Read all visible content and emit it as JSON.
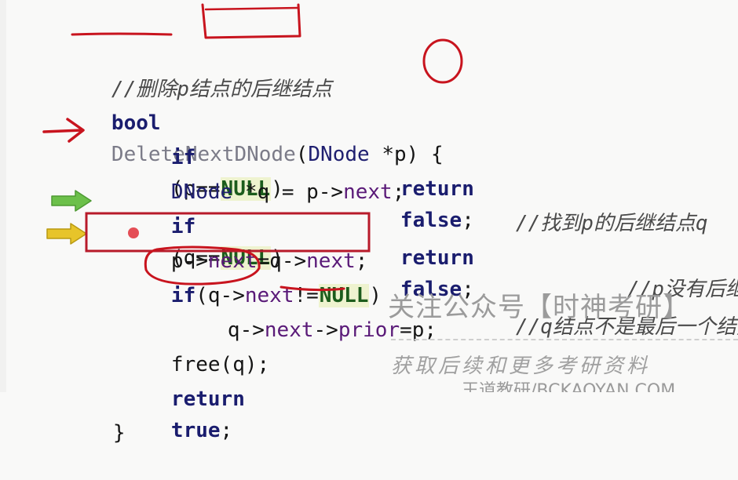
{
  "code": {
    "comment_header": "//删除p结点的后继结点",
    "l1": {
      "kw": "bool",
      "fn": "DeleteNextDNode",
      "open": "(",
      "type": "DNode",
      "param": " *p",
      "close": ") {"
    },
    "l2": {
      "kw_if": "if",
      "cond_open": "(p==",
      "null": "NULL",
      "cond_close": ")",
      "ret": "return",
      "val": "false",
      "semi": ";"
    },
    "l3": {
      "type": "DNode",
      "code": " *q = p->",
      "field": "next",
      "semi": ";",
      "comment": "//找到p的后继结点q"
    },
    "l4": {
      "kw_if": "if",
      "cond_open": "(q==",
      "null": "NULL",
      "cond_close": ")",
      "ret": "return",
      "val": "false",
      "semi": ";",
      "comment": "//p没有后继"
    },
    "l5": {
      "a": "p->",
      "f1": "next",
      "b": "=q->",
      "f2": "next",
      "semi": ";"
    },
    "l6": {
      "kw_if": "if",
      "cond_open": "(q->",
      "field": "next",
      "neq": "!=",
      "null": "NULL",
      "cond_close": ")",
      "comment": "//q结点不是最后一个结点"
    },
    "l7": {
      "a": "q->",
      "f1": "next",
      "b": "->",
      "f2": "prior",
      "c": "=p;"
    },
    "l8": {
      "fn": "free",
      "code": "(q);"
    },
    "l9": {
      "kw": "return",
      "val": "true",
      "semi": ";"
    },
    "l10": {
      "brace": "}"
    }
  },
  "watermark": {
    "line1": "关注公众号【时神考研】",
    "line2": "获取后续和更多考研资料",
    "line3": "王道教研/BCKAOYAN.COM"
  },
  "colors": {
    "annotation_red": "#c8141e",
    "arrow_green": "#6cc04a",
    "arrow_yellow": "#e7c42a",
    "box_red": "#b81a2a"
  }
}
